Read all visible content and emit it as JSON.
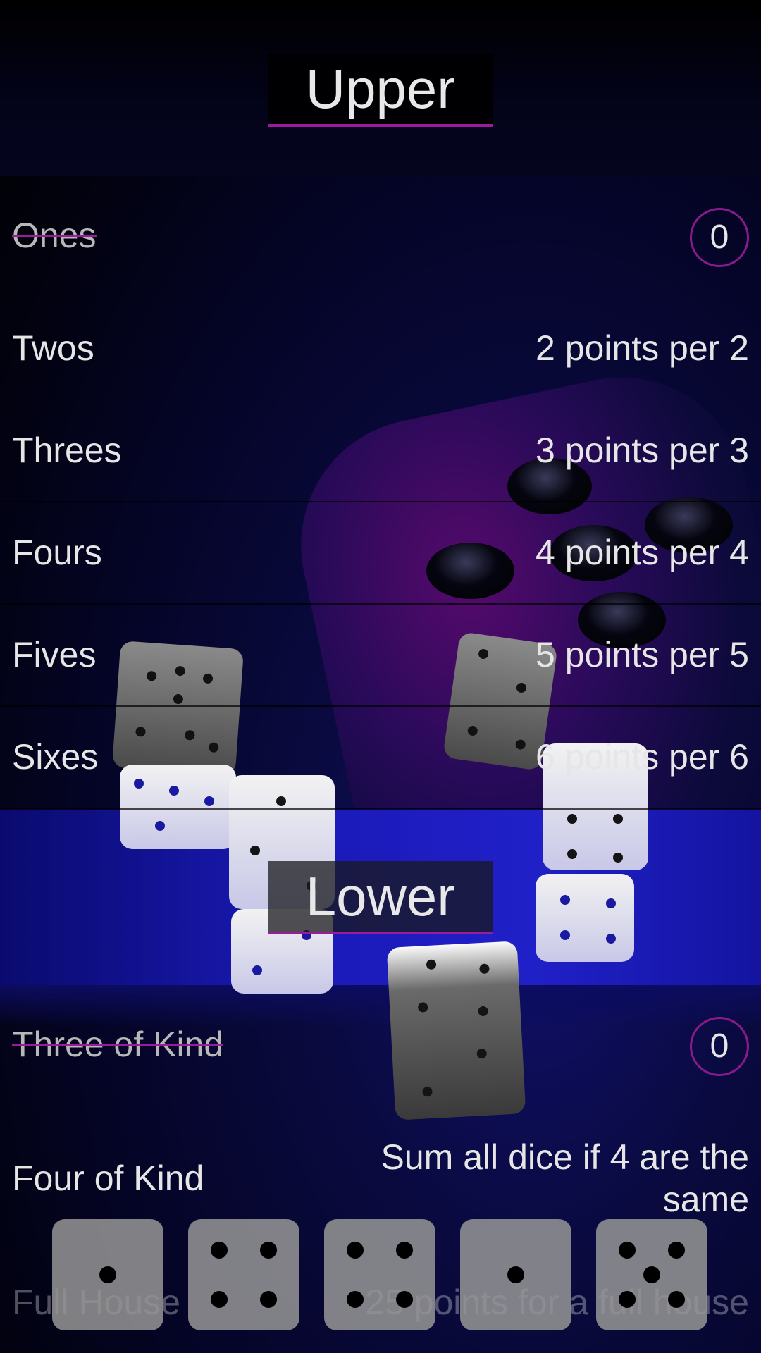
{
  "upper": {
    "title": "Upper",
    "rows": [
      {
        "label": "Ones",
        "value": "0",
        "used": true
      },
      {
        "label": "Twos",
        "value": "2 points per 2"
      },
      {
        "label": "Threes",
        "value": "3 points per 3"
      },
      {
        "label": "Fours",
        "value": "4 points per 4"
      },
      {
        "label": "Fives",
        "value": "5 points per 5"
      },
      {
        "label": "Sixes",
        "value": "6 points per 6"
      }
    ]
  },
  "lower": {
    "title": "Lower",
    "rows": [
      {
        "label": "Three of Kind",
        "value": "0",
        "used": true
      },
      {
        "label": "Four of Kind",
        "value": "Sum all dice if 4 are the same"
      },
      {
        "label": "Full House",
        "value": "25 points for a full house"
      }
    ]
  },
  "dice": [
    {
      "name": "die-1",
      "value": 1
    },
    {
      "name": "die-2",
      "value": 4
    },
    {
      "name": "die-3",
      "value": 4
    },
    {
      "name": "die-4",
      "value": 1
    },
    {
      "name": "die-5",
      "value": 5
    }
  ],
  "colors": {
    "accent": "#9b1b9b",
    "die_face": "#969696",
    "pip": "#000000"
  }
}
